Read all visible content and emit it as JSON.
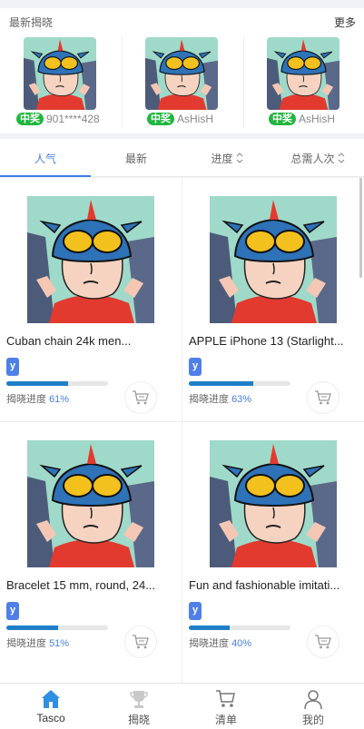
{
  "winners": {
    "title": "最新揭晓",
    "more": "更多",
    "items": [
      {
        "badge": "中奖",
        "name": "901****428"
      },
      {
        "badge": "中奖",
        "name": "AsHisH"
      },
      {
        "badge": "中奖",
        "name": "AsHisH"
      }
    ]
  },
  "tabs": [
    {
      "label": "人气"
    },
    {
      "label": "最新"
    },
    {
      "label": "进度"
    },
    {
      "label": "总需人次"
    }
  ],
  "products": [
    {
      "title": "Cuban chain 24k men...",
      "tag": "y",
      "progress_label": "揭晓进度",
      "progress": "61%",
      "progress_value": 0.61
    },
    {
      "title": "APPLE iPhone 13 (Starlight...",
      "tag": "y",
      "progress_label": "揭晓进度",
      "progress": "63%",
      "progress_value": 0.63
    },
    {
      "title": "Bracelet 15 mm, round, 24...",
      "tag": "y",
      "progress_label": "揭晓进度",
      "progress": "51%",
      "progress_value": 0.51
    },
    {
      "title": "Fun and fashionable imitati...",
      "tag": "y",
      "progress_label": "揭晓进度",
      "progress": "40%",
      "progress_value": 0.4
    }
  ],
  "nav": [
    {
      "label": "Tasco",
      "icon": "home-icon"
    },
    {
      "label": "揭晓",
      "icon": "trophy-icon"
    },
    {
      "label": "清单",
      "icon": "cart-icon"
    },
    {
      "label": "我的",
      "icon": "user-icon"
    }
  ],
  "colors": {
    "accent": "#3b7de2",
    "badge": "#20b73f",
    "progress": "#1e7ec8",
    "tag": "#4f7fe8"
  }
}
